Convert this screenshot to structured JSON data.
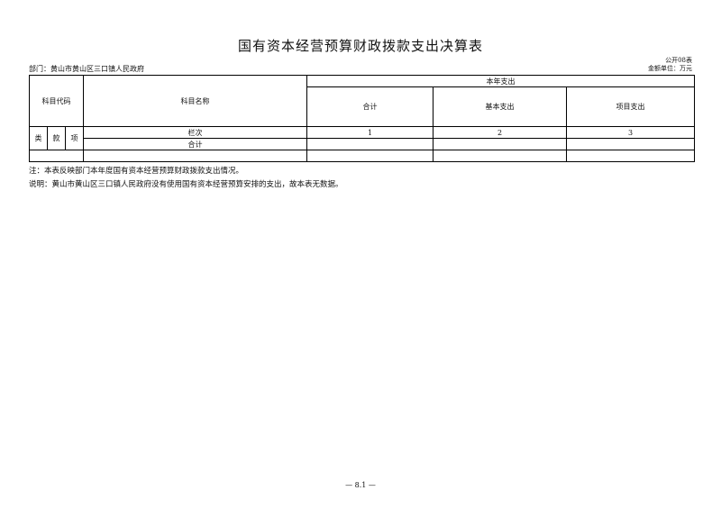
{
  "document": {
    "title": "国有资本经营预算财政拨款支出决算表",
    "form_no": "公开08表",
    "department": "部门：黄山市黄山区三口镇人民政府",
    "unit": "金额单位：万元"
  },
  "table": {
    "header": {
      "subject_code": "科目代码",
      "subject_name": "科目名称",
      "year_expense": "本年支出",
      "total": "合计",
      "basic": "基本支出",
      "project": "项目支出"
    },
    "code_cols": [
      "类",
      "款",
      "项"
    ],
    "column_row": {
      "label": "栏次",
      "c1": "1",
      "c2": "2",
      "c3": "3"
    },
    "total_row": {
      "label": "合计"
    }
  },
  "notes": {
    "note1": "注：本表反映部门本年度国有资本经营预算财政拨款支出情况。",
    "note2": "说明：黄山市黄山区三口镇人民政府没有使用国有资本经营预算安排的支出，故本表无数据。"
  },
  "page_number": "— 8.1 —"
}
